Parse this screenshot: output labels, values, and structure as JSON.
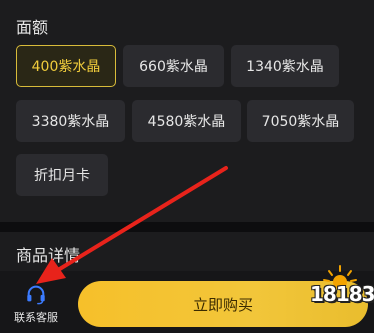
{
  "amount": {
    "title": "面额",
    "options": [
      {
        "label": "400紫水晶",
        "selected": true
      },
      {
        "label": "660紫水晶",
        "selected": false
      },
      {
        "label": "1340紫水晶",
        "selected": false
      },
      {
        "label": "3380紫水晶",
        "selected": false
      },
      {
        "label": "4580紫水晶",
        "selected": false
      },
      {
        "label": "7050紫水晶",
        "selected": false
      },
      {
        "label": "折扣月卡",
        "selected": false
      }
    ]
  },
  "details": {
    "title": "商品详情"
  },
  "bottom_bar": {
    "customer_service_label": "联系客服",
    "buy_label": "立即购买"
  },
  "watermark": {
    "text": "18183"
  },
  "colors": {
    "accent": "#f0cc3c",
    "buy_button": "#f6c02a",
    "arrow": "#e8231b",
    "headset_icon": "#3b7bff"
  },
  "icons": {
    "customer_service": "headset-icon",
    "annotation": "red-arrow-annotation",
    "watermark_logo": "sun-logo-icon"
  }
}
